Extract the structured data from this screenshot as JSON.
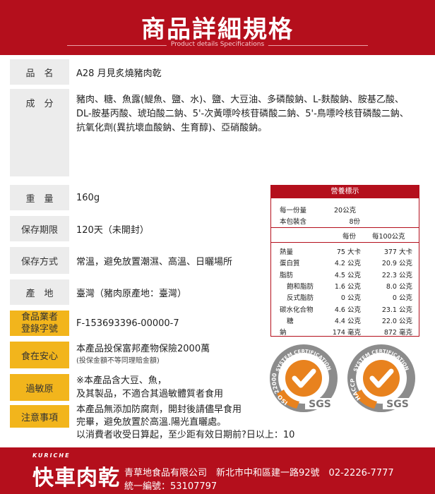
{
  "header": {
    "title": "商品詳細規格",
    "subtitle": "Product details Specifications"
  },
  "rows": {
    "name": {
      "label": "品　名",
      "value": "A28 月見炙燒豬肉乾"
    },
    "ingredients": {
      "label": "成　分",
      "lines": [
        "豬肉、糖、魚露(鯷魚、鹽、水)、鹽、大豆油、多磷酸鈉、L-麩酸鈉、胺基乙酸、",
        "DL-胺基丙酸、琥珀酸二鈉、5'-次黃嘌呤核苷磷酸二鈉、5'-鳥嘌呤核苷磷酸二鈉、",
        "抗氧化劑(異抗壞血酸鈉、生育醇)、亞硝酸鈉。"
      ]
    },
    "weight": {
      "label": "重　量",
      "value": "160g"
    },
    "shelf_life": {
      "label": "保存期限",
      "value": "120天（未開封）"
    },
    "storage": {
      "label": "保存方式",
      "value": "常溫，避免放置潮濕、高溫、日曬場所"
    },
    "origin": {
      "label": "產　地",
      "value": "臺灣（豬肉原產地：臺灣）"
    },
    "registration": {
      "label_line1": "食品業者",
      "label_line2": "登錄字號",
      "value": "F-153693396-00000-7"
    },
    "insurance": {
      "label": "食在安心",
      "value": "本產品投保富邦產物保險2000萬",
      "note": "(投保金額不等同理賠金額)"
    },
    "allergen": {
      "label": "過敏原",
      "line1": "※本產品含大豆、魚，",
      "line2": "及其製品，不適合其過敏體質者食用"
    },
    "notes": {
      "label": "注意事項",
      "line1": "本產品無添加防腐劑，開封後請儘早食用",
      "line2": "完畢，避免放置於高溫.陽光直曬處。",
      "line3": "以消費者收受日算起，至少距有效日期前?日以上：10"
    }
  },
  "nutrition": {
    "title": "營養標示",
    "serving_size_label": "每一份量",
    "serving_size": "20公克",
    "servings_label": "本包裝含",
    "servings": "8份",
    "col_per_serving": "每份",
    "col_per_100g": "每100公克",
    "items": [
      {
        "name": "熱量",
        "per_serving": "75 大卡",
        "per_100g": "377 大卡",
        "indent": false
      },
      {
        "name": "蛋白質",
        "per_serving": "4.2 公克",
        "per_100g": "20.9 公克",
        "indent": false
      },
      {
        "name": "脂肪",
        "per_serving": "4.5 公克",
        "per_100g": "22.3 公克",
        "indent": false
      },
      {
        "name": "飽和脂肪",
        "per_serving": "1.6 公克",
        "per_100g": "8.0 公克",
        "indent": true
      },
      {
        "name": "反式脂肪",
        "per_serving": "0 公克",
        "per_100g": "0 公克",
        "indent": true
      },
      {
        "name": "碳水化合物",
        "per_serving": "4.6 公克",
        "per_100g": "23.1 公克",
        "indent": false
      },
      {
        "name": "糖",
        "per_serving": "4.4 公克",
        "per_100g": "22.0 公克",
        "indent": true
      },
      {
        "name": "鈉",
        "per_serving": "174 毫克",
        "per_100g": "872 毫克",
        "indent": false
      }
    ]
  },
  "certifications": [
    {
      "ring_text": "SYSTEM CERTIFICATION",
      "standard": "ISO 22000",
      "brand": "SGS"
    },
    {
      "ring_text": "SYSTEM CERTIFICATION",
      "standard": "HACCP",
      "brand": "SGS"
    }
  ],
  "footer": {
    "brand_small": "KURICHE",
    "brand": "快車肉乾",
    "info_line1": "青草地食品有限公司　新北市中和區建一路92號　02-2226-7777",
    "info_line2": "統一編號：53107797"
  },
  "colors": {
    "brand_red": "#b40f1c",
    "label_gray": "#ececec",
    "label_yellow": "#f2b51c",
    "cert_orange": "#e8821e"
  }
}
